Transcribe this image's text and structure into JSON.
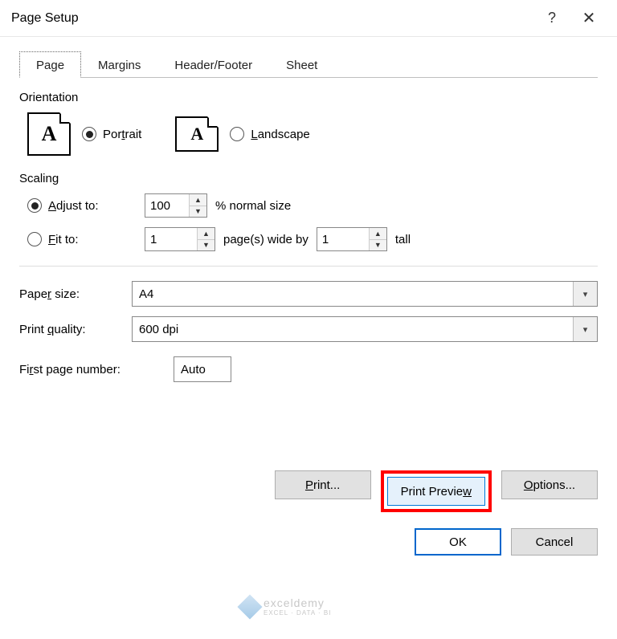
{
  "titlebar": {
    "title": "Page Setup"
  },
  "tabs": [
    "Page",
    "Margins",
    "Header/Footer",
    "Sheet"
  ],
  "active_tab": 0,
  "orientation": {
    "label": "Orientation",
    "portrait": "Portrait",
    "landscape": "Landscape",
    "selected": "portrait"
  },
  "scaling": {
    "label": "Scaling",
    "adjust_label": "Adjust to:",
    "adjust_value": "100",
    "adjust_suffix": "% normal size",
    "fit_label": "Fit to:",
    "fit_wide": "1",
    "fit_mid": "page(s) wide by",
    "fit_tall_val": "1",
    "fit_tall_suffix": "tall",
    "selected": "adjust"
  },
  "paper": {
    "size_label": "Paper size:",
    "size_value": "A4",
    "quality_label": "Print quality:",
    "quality_value": "600 dpi"
  },
  "firstpage": {
    "label": "First page number:",
    "value": "Auto"
  },
  "buttons": {
    "print": "Print...",
    "preview": "Print Preview",
    "options": "Options...",
    "ok": "OK",
    "cancel": "Cancel"
  },
  "watermark": {
    "brand": "exceldemy",
    "sub": "EXCEL · DATA · BI"
  }
}
